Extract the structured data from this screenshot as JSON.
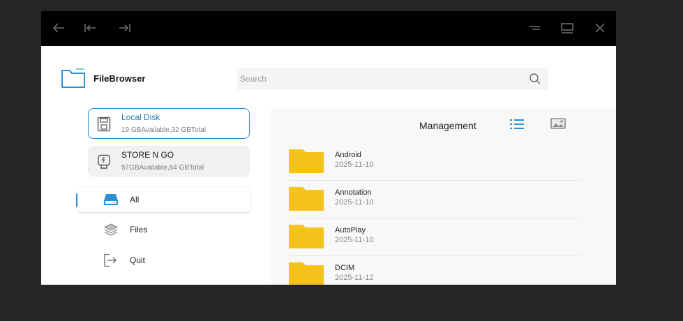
{
  "app": {
    "title": "FileBrowser"
  },
  "search": {
    "placeholder": "Search"
  },
  "disks": [
    {
      "name": "Local Disk",
      "info": "19 GBAvailable,32 GBTotal",
      "selected": true
    },
    {
      "name": "STORE N GO",
      "info": "57GBAvailable,64 GBTotal",
      "selected": false
    }
  ],
  "nav": [
    {
      "label": "All",
      "icon": "drive-icon",
      "active": true
    },
    {
      "label": "Files",
      "icon": "layers-icon",
      "active": false
    },
    {
      "label": "Quit",
      "icon": "exit-icon",
      "active": false
    }
  ],
  "main": {
    "title": "Management"
  },
  "folders": [
    {
      "name": "Android",
      "date": "2025-11-10"
    },
    {
      "name": "Annotation",
      "date": "2025-11-10"
    },
    {
      "name": "AutoPlay",
      "date": "2025-11-10"
    },
    {
      "name": "DCIM",
      "date": "2025-11-12"
    }
  ],
  "colors": {
    "accent": "#2f8fd0",
    "folder": "#f5c518",
    "titlebar": "#000000",
    "backdrop": "#252525"
  }
}
